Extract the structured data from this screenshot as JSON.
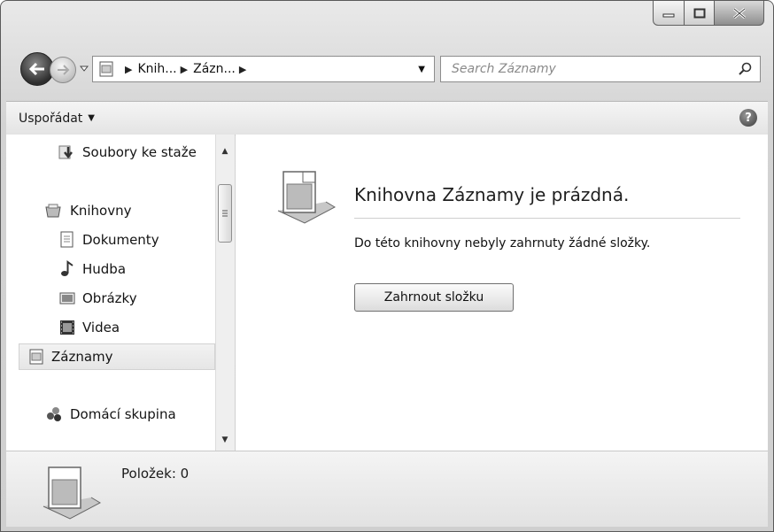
{
  "window": {
    "min_icon": "minimize-icon",
    "max_icon": "maximize-icon",
    "close_icon": "close-icon"
  },
  "navigation": {
    "back_icon": "back-arrow-icon",
    "forward_icon": "forward-arrow-icon",
    "address": {
      "segments": [
        "Knih...",
        "Zázn..."
      ]
    },
    "refresh_icon": "refresh-icon",
    "search_placeholder": "Search Záznamy"
  },
  "commandbar": {
    "organize_label": "Uspořádat",
    "help_label": "?"
  },
  "sidebar": {
    "items": [
      {
        "label": "Soubory ke staže",
        "icon": "downloads-icon"
      },
      {
        "label": "Knihovny",
        "icon": "libraries-icon"
      },
      {
        "label": "Dokumenty",
        "icon": "document-icon"
      },
      {
        "label": "Hudba",
        "icon": "music-icon"
      },
      {
        "label": "Obrázky",
        "icon": "picture-icon"
      },
      {
        "label": "Videa",
        "icon": "video-icon"
      },
      {
        "label": "Záznamy",
        "icon": "recordings-icon",
        "selected": true
      },
      {
        "label": "Domácí skupina",
        "icon": "homegroup-icon"
      }
    ]
  },
  "content": {
    "title": "Knihovna Záznamy je prázdná.",
    "description": "Do této knihovny nebyly zahrnuty žádné složky.",
    "include_button": "Zahrnout složku"
  },
  "status": {
    "items_label": "Položek: 0"
  }
}
